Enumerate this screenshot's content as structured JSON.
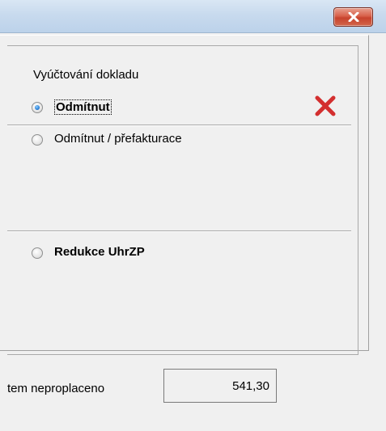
{
  "window": {
    "close_icon": "close-icon"
  },
  "group": {
    "title": "Vyúčtování dokladu",
    "status_icon": "red-x-icon",
    "status_color": "#d32f2f"
  },
  "options": [
    {
      "label": "Odmítnut",
      "checked": true
    },
    {
      "label": "Odmítnut / přefakturace",
      "checked": false
    },
    {
      "label": "Redukce UhrZP",
      "checked": false
    }
  ],
  "footer": {
    "total_label": "tem neproplaceno",
    "total_value": "541,30"
  }
}
